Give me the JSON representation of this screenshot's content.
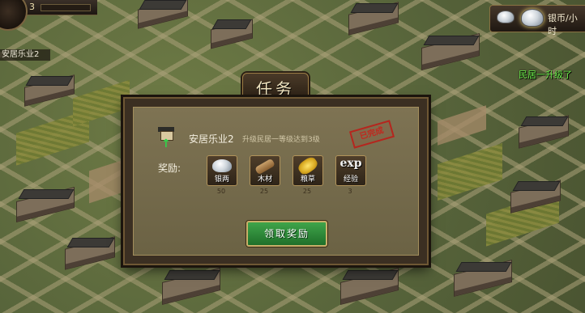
{
  "hud": {
    "level": "3",
    "area": "安居乐业2",
    "currency_label": "银币/小时",
    "notice": "民居一升级了"
  },
  "dialog": {
    "title": "任务",
    "quest": {
      "name": "安居乐业2",
      "description": "升级民居一等级达到3级",
      "stamp": "已完成",
      "icon": "house-upgrade-icon"
    },
    "reward_label": "奖励:",
    "rewards": [
      {
        "name": "银两",
        "qty": "50",
        "icon": "silver-ingot-icon"
      },
      {
        "name": "木材",
        "qty": "25",
        "icon": "wood-icon"
      },
      {
        "name": "粮草",
        "qty": "25",
        "icon": "grain-icon"
      },
      {
        "name": "经验",
        "qty": "3",
        "icon": "exp-icon",
        "badge": "exp"
      }
    ],
    "claim_button": "领取奖励"
  },
  "colors": {
    "button_green": "#2f8a3a",
    "stamp_red": "#c0281f",
    "notice_green": "#6cf04a"
  }
}
